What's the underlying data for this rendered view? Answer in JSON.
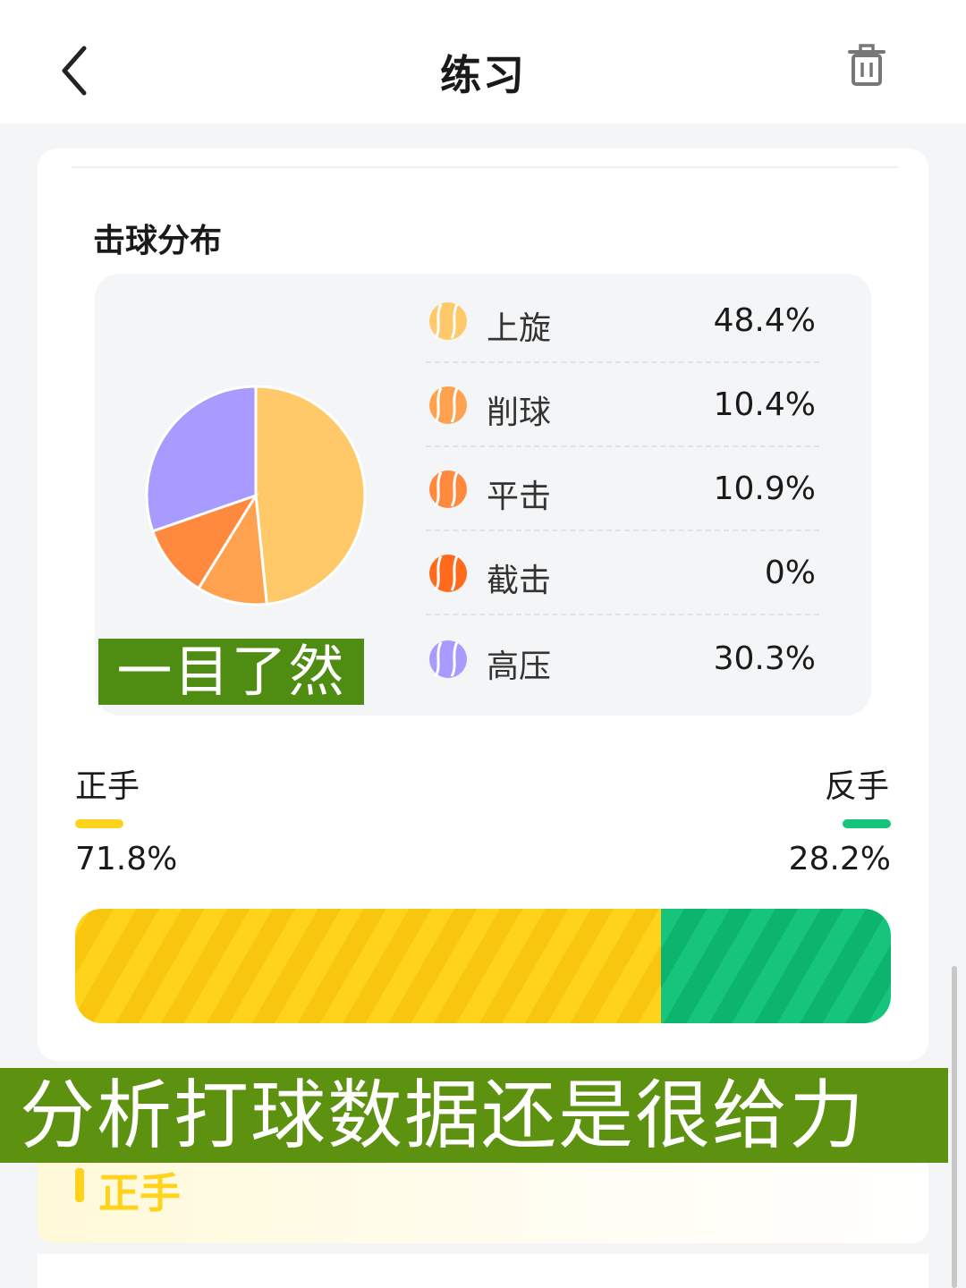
{
  "header": {
    "title": "练习",
    "back_icon": "chevron-left-icon",
    "delete_icon": "trash-icon"
  },
  "distribution": {
    "title": "击球分布",
    "items": [
      {
        "label": "上旋",
        "percent": "48.4%",
        "color": "#ffc96a"
      },
      {
        "label": "削球",
        "percent": "10.4%",
        "color": "#ffa24f"
      },
      {
        "label": "平击",
        "percent": "10.9%",
        "color": "#ff8a3d"
      },
      {
        "label": "截击",
        "percent": "0%",
        "color": "#ff6a1c"
      },
      {
        "label": "高压",
        "percent": "30.3%",
        "color": "#a79bff"
      }
    ]
  },
  "chart_data": {
    "type": "pie",
    "categories": [
      "上旋",
      "削球",
      "平击",
      "截击",
      "高压"
    ],
    "values": [
      48.4,
      10.4,
      10.9,
      0,
      30.3
    ],
    "colors": [
      "#ffc96a",
      "#ffa24f",
      "#ff8a3d",
      "#ff6a1c",
      "#a79bff"
    ]
  },
  "overlay_small": "一目了然",
  "hands": {
    "forehand": {
      "label": "正手",
      "percent": "71.8%",
      "value": 71.8,
      "color": "#ffd21c"
    },
    "backhand": {
      "label": "反手",
      "percent": "28.2%",
      "value": 28.2,
      "color": "#17c47c"
    }
  },
  "caption": "分析打球数据还是很给力",
  "next_section": {
    "title": "正手"
  }
}
